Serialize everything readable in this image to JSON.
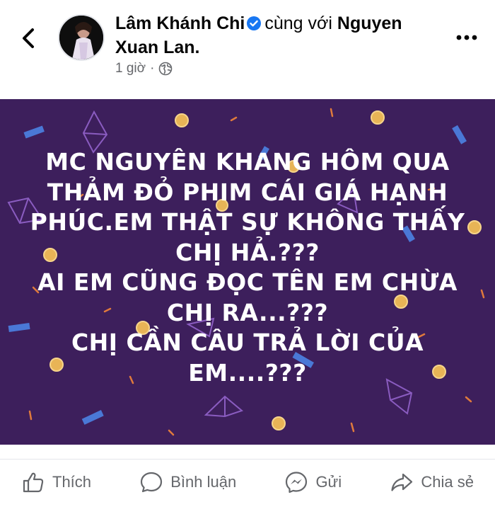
{
  "header": {
    "author": "Lâm Khánh Chi",
    "with_text": "cùng với",
    "tagged": "Nguyen Xuan Lan.",
    "time": "1 giờ",
    "dot": "·"
  },
  "post": {
    "background_color": "#3d1f5c",
    "lines": [
      "MC NGUYÊN KHANG HÔM QUA",
      "THẢM ĐỎ PHIM CÁI GIÁ HẠNH",
      "PHÚC.EM THẬT SỰ KHÔNG THẤY",
      "CHỊ HẢ.???",
      "AI EM CŨNG ĐỌC TÊN EM CHỪA",
      "CHỊ RA...???",
      "CHỊ CẦN CÂU TRẢ LỜI CỦA",
      "EM....???"
    ]
  },
  "actions": {
    "like": "Thích",
    "comment": "Bình luận",
    "send": "Gửi",
    "share": "Chia sẻ"
  },
  "colors": {
    "verified": "#1877f2",
    "muted": "#65676b"
  }
}
